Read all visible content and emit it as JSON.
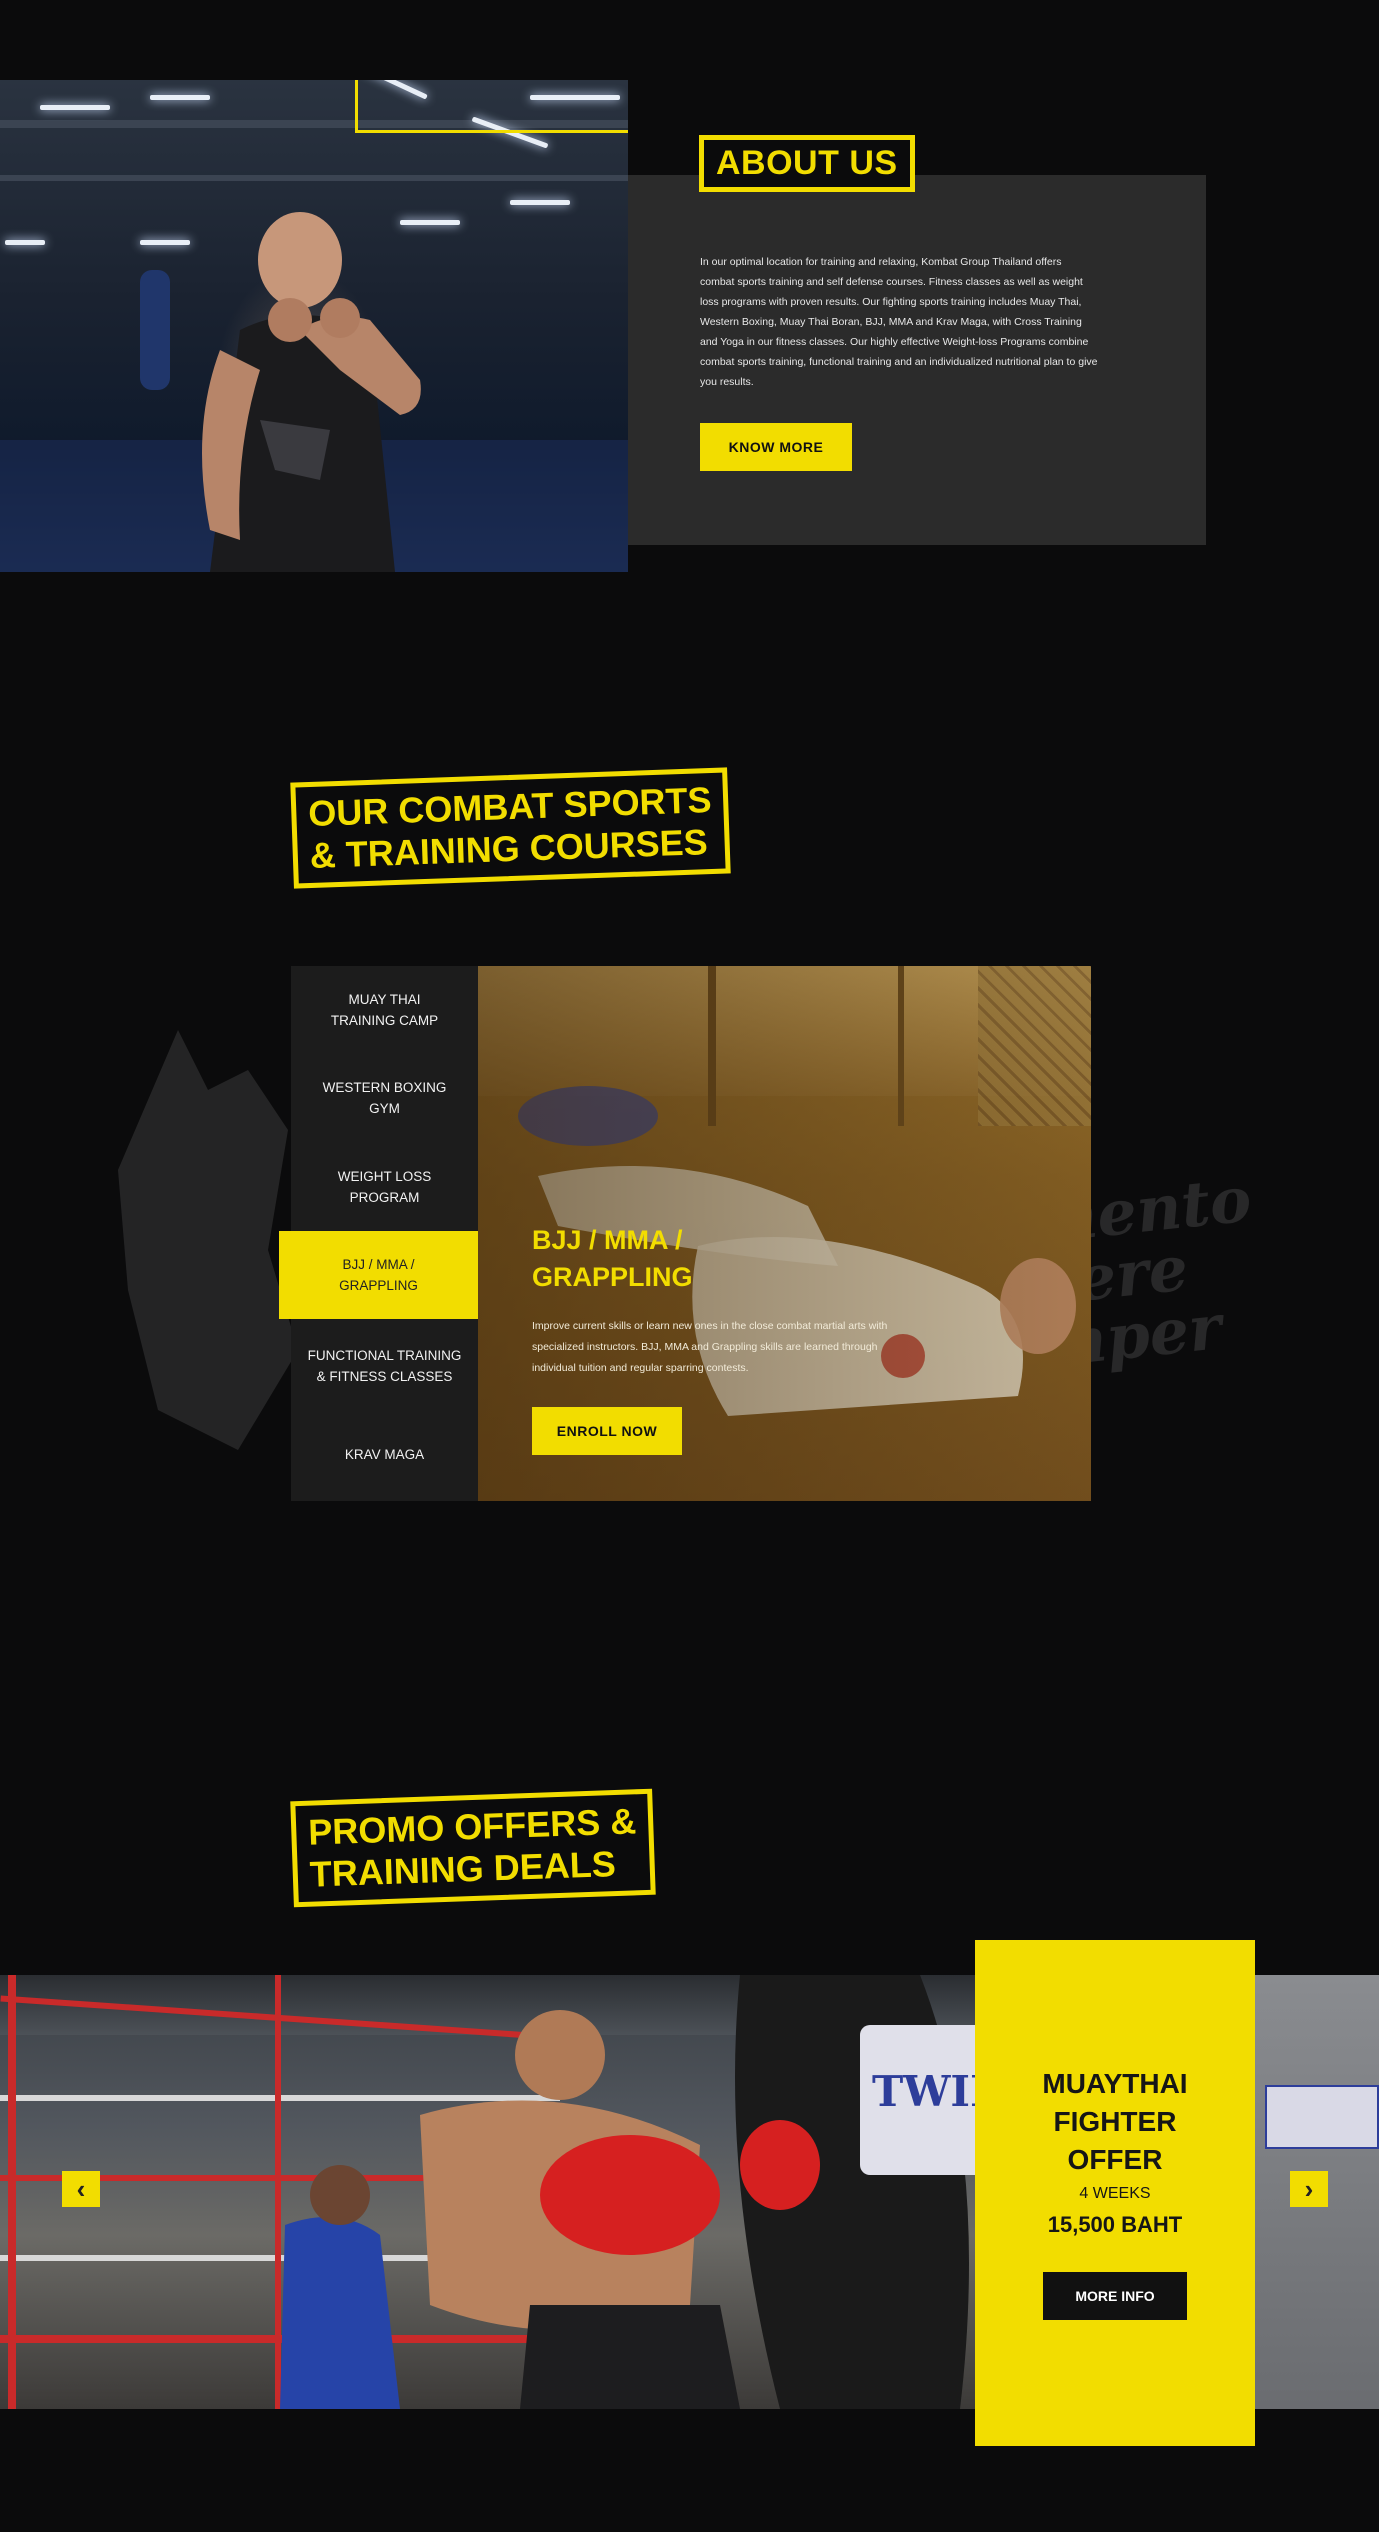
{
  "about": {
    "heading": "ABOUT US",
    "text": "In our optimal location for training and relaxing, Kombat Group Thailand offers combat sports training and self defense courses. Fitness classes as well as weight loss programs with proven results. Our fighting sports training includes Muay Thai, Western Boxing, Muay Thai Boran, BJJ, MMA and Krav Maga, with Cross Training and Yoga in our fitness classes. Our highly effective Weight-loss Programs combine combat sports training, functional training and an individualized nutritional plan to give you results.",
    "button": "KNOW MORE"
  },
  "courses": {
    "heading_line1": "OUR COMBAT SPORTS",
    "heading_line2": "& TRAINING COURSES",
    "items": [
      {
        "line1": "MUAY THAI",
        "line2": "TRAINING CAMP"
      },
      {
        "line1": "WESTERN BOXING",
        "line2": "GYM"
      },
      {
        "line1": "WEIGHT LOSS",
        "line2": "PROGRAM"
      },
      {
        "line1": "BJJ / MMA /",
        "line2": "GRAPPLING"
      },
      {
        "line1": "FUNCTIONAL TRAINING",
        "line2": "& FITNESS CLASSES"
      },
      {
        "line1": "KRAV MAGA",
        "line2": ""
      }
    ],
    "active_index": 3,
    "panel": {
      "title_line1": "BJJ / MMA /",
      "title_line2": "GRAPPLING",
      "description": "Improve current skills or learn new ones in the close combat martial arts with specialized instructors. BJJ, MMA and Grappling skills are learned through individual tuition and regular sparring contests.",
      "button": "ENROLL NOW"
    },
    "watermark": [
      "Memento",
      "Audere",
      "Semper"
    ]
  },
  "promo": {
    "heading_line1": "PROMO OFFERS &",
    "heading_line2": "TRAINING DEALS",
    "card": {
      "title_line1": "MUAYTHAI",
      "title_line2": "FIGHTER",
      "title_line3": "OFFER",
      "duration": "4 WEEKS",
      "price": "15,500 BAHT",
      "button": "MORE INFO"
    },
    "prev_arrow": "‹",
    "next_arrow": "›",
    "bag_text": "TWINS"
  },
  "colors": {
    "accent": "#f2dd00",
    "background": "#0b0b0c",
    "card": "#2b2b2b"
  }
}
